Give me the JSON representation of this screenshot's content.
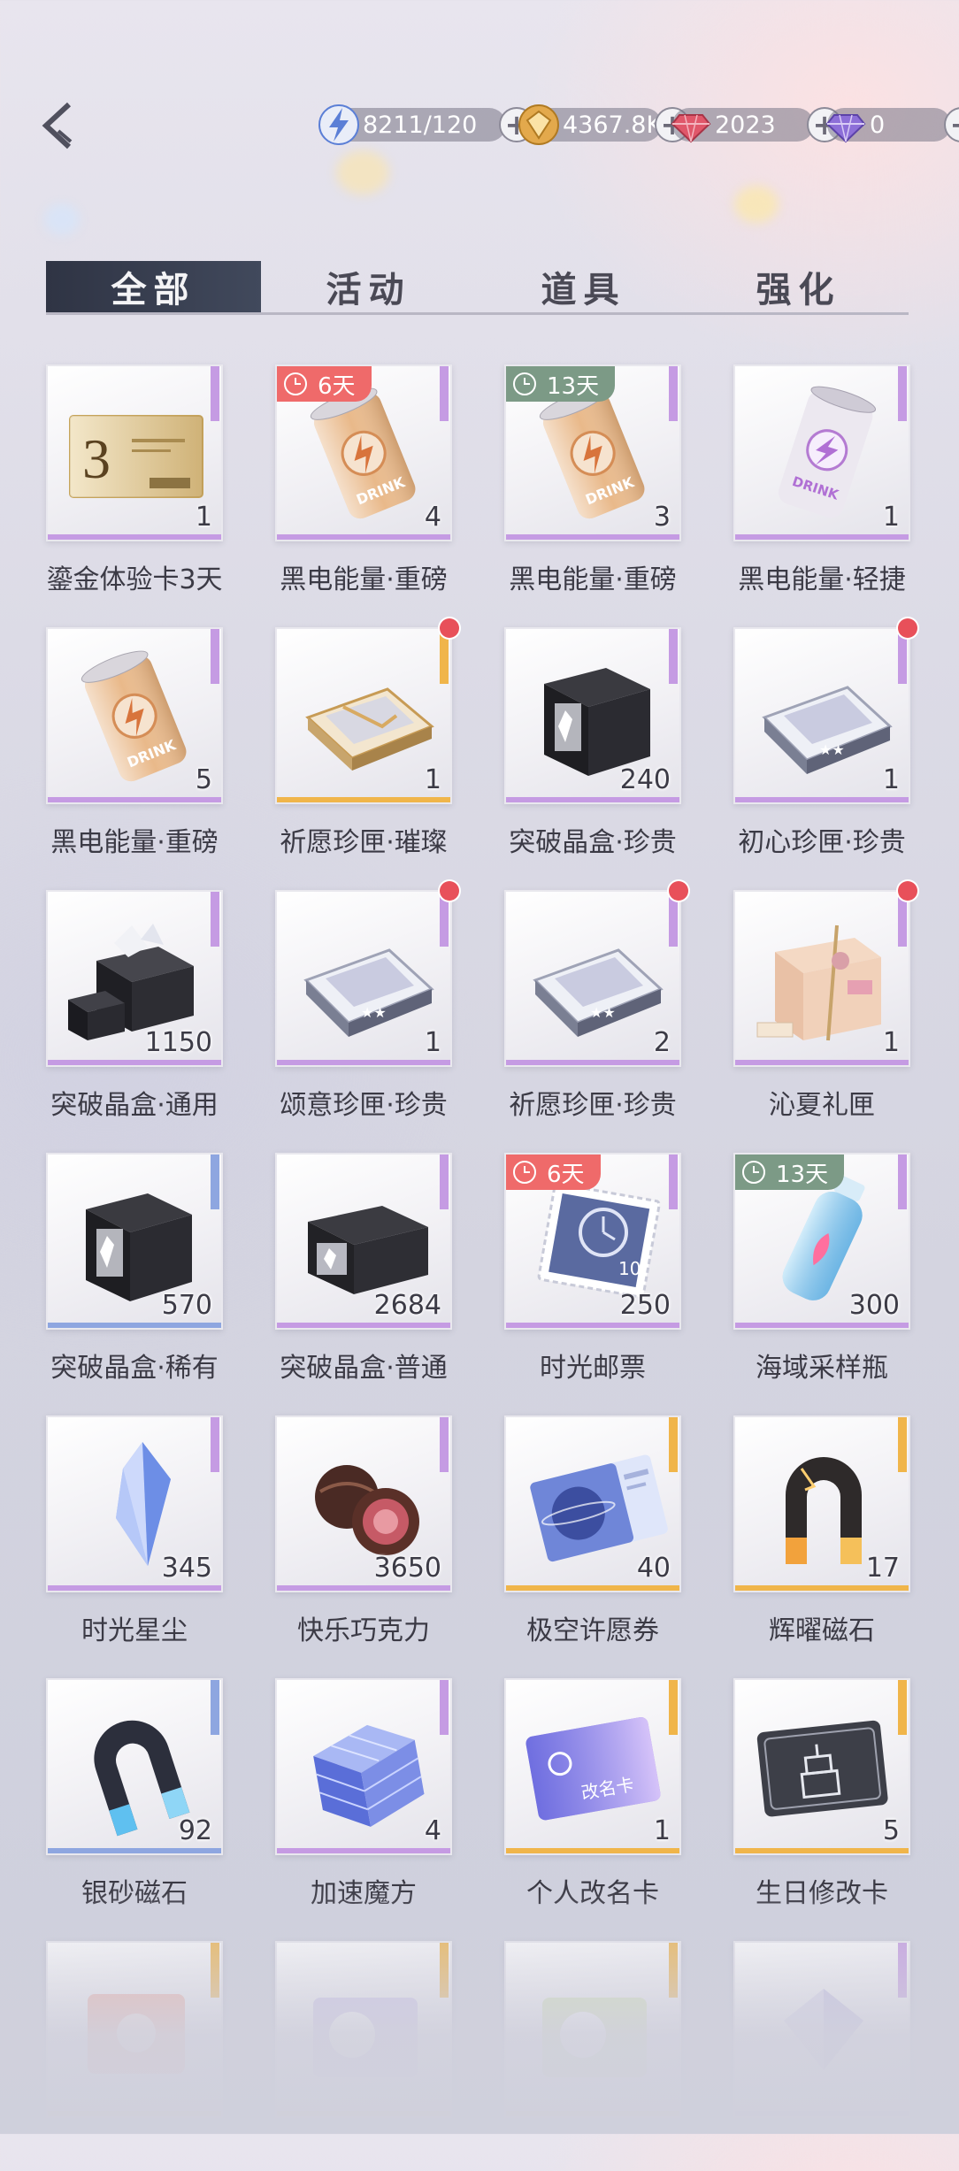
{
  "header": {
    "currencies": [
      {
        "icon": "stamina-bolt-icon",
        "value": "8211/120",
        "color": "#5b7fd6"
      },
      {
        "icon": "gold-coin-icon",
        "value": "4367.8K",
        "color": "#e3a94c"
      },
      {
        "icon": "red-diamond-icon",
        "value": "2023",
        "color": "#e0576a"
      },
      {
        "icon": "purple-diamond-icon",
        "value": "0",
        "color": "#8d6fd8"
      }
    ],
    "plus": "+"
  },
  "tabs": [
    {
      "label": "全部",
      "active": true
    },
    {
      "label": "活动",
      "active": false
    },
    {
      "label": "道具",
      "active": false
    },
    {
      "label": "强化",
      "active": false
    }
  ],
  "colors": {
    "purple": "#c59be3",
    "gold": "#f0b54a",
    "blue": "#8ea6e0",
    "timer_red": "#ef6a6a",
    "timer_green": "#7c9a86"
  },
  "items": [
    {
      "name": "鎏金体验卡3天",
      "qty": "1",
      "rarity": "purple",
      "art": "card-3"
    },
    {
      "name": "黑电能量·重磅",
      "qty": "4",
      "rarity": "purple",
      "art": "can-gold",
      "timer": "6天",
      "timer_color": "red"
    },
    {
      "name": "黑电能量·重磅",
      "qty": "3",
      "rarity": "purple",
      "art": "can-gold",
      "timer": "13天",
      "timer_color": "green"
    },
    {
      "name": "黑电能量·轻捷",
      "qty": "1",
      "rarity": "purple",
      "art": "can-silver"
    },
    {
      "name": "黑电能量·重磅",
      "qty": "5",
      "rarity": "purple",
      "art": "can-gold"
    },
    {
      "name": "祈愿珍匣·璀璨",
      "qty": "1",
      "rarity": "gold",
      "art": "box-gold",
      "dot": true
    },
    {
      "name": "突破晶盒·珍贵",
      "qty": "240",
      "rarity": "purple",
      "art": "cube-black"
    },
    {
      "name": "初心珍匣·珍贵",
      "qty": "1",
      "rarity": "purple",
      "art": "box-silver",
      "dot": true
    },
    {
      "name": "突破晶盒·通用",
      "qty": "1150",
      "rarity": "purple",
      "art": "crates"
    },
    {
      "name": "颂意珍匣·珍贵",
      "qty": "1",
      "rarity": "purple",
      "art": "box-silver",
      "dot": true
    },
    {
      "name": "祈愿珍匣·珍贵",
      "qty": "2",
      "rarity": "purple",
      "art": "box-silver",
      "dot": true
    },
    {
      "name": "沁夏礼匣",
      "qty": "1",
      "rarity": "purple",
      "art": "gift-box",
      "dot": true
    },
    {
      "name": "突破晶盒·稀有",
      "qty": "570",
      "rarity": "blue",
      "art": "cube-black"
    },
    {
      "name": "突破晶盒·普通",
      "qty": "2684",
      "rarity": "purple",
      "art": "cube-flat"
    },
    {
      "name": "时光邮票",
      "qty": "250",
      "rarity": "purple",
      "art": "stamp",
      "timer": "6天",
      "timer_color": "red"
    },
    {
      "name": "海域采样瓶",
      "qty": "300",
      "rarity": "purple",
      "art": "bottle",
      "timer": "13天",
      "timer_color": "green"
    },
    {
      "name": "时光星尘",
      "qty": "345",
      "rarity": "purple",
      "art": "crystal"
    },
    {
      "name": "快乐巧克力",
      "qty": "3650",
      "rarity": "purple",
      "art": "chocolate"
    },
    {
      "name": "极空许愿券",
      "qty": "40",
      "rarity": "gold",
      "art": "ticket"
    },
    {
      "name": "辉曜磁石",
      "qty": "17",
      "rarity": "gold",
      "art": "magnet-gold"
    },
    {
      "name": "银砂磁石",
      "qty": "92",
      "rarity": "blue",
      "art": "magnet-blue"
    },
    {
      "name": "加速魔方",
      "qty": "4",
      "rarity": "purple",
      "art": "rubik"
    },
    {
      "name": "个人改名卡",
      "qty": "1",
      "rarity": "gold",
      "art": "rename-card"
    },
    {
      "name": "生日修改卡",
      "qty": "5",
      "rarity": "gold",
      "art": "birthday-card"
    },
    {
      "name": "",
      "qty": "",
      "rarity": "gold",
      "art": "partial-1"
    },
    {
      "name": "",
      "qty": "",
      "rarity": "gold",
      "art": "partial-2"
    },
    {
      "name": "",
      "qty": "",
      "rarity": "gold",
      "art": "partial-3"
    },
    {
      "name": "",
      "qty": "",
      "rarity": "purple",
      "art": "partial-4"
    }
  ]
}
